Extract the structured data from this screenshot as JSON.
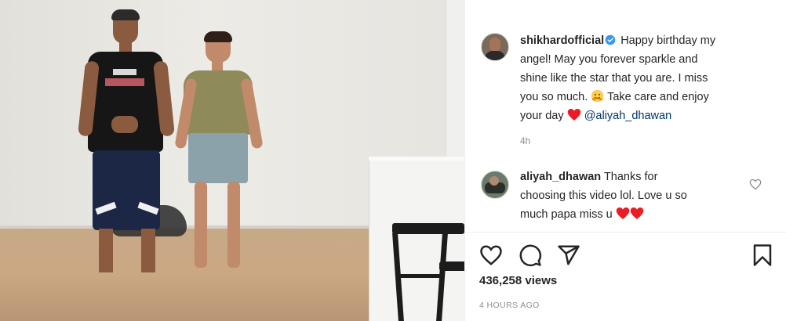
{
  "post": {
    "author": "shikhardofficial",
    "caption_line1": "Happy birthday my",
    "caption_line2": "angel! May you forever sparkle and",
    "caption_line3": "shine like the star that you are. I miss",
    "caption_line4": "you so much.",
    "caption_line5a": "Take care and enjoy",
    "caption_line6a": "your day",
    "mention": "@aliyah_dhawan",
    "caption_time": "4h"
  },
  "comment": {
    "author": "aliyah_dhawan",
    "line1": "Thanks for",
    "line2": "choosing this video lol. Love u so",
    "line3": "much papa miss u"
  },
  "stats": {
    "views": "436,258 views",
    "posted": "4 HOURS AGO"
  },
  "icons": {
    "like": "heart-outline-icon",
    "comment": "comment-bubble-icon",
    "share": "paper-plane-icon",
    "save": "bookmark-icon",
    "verified": "verified-badge-icon",
    "heart_emoji": "red-heart-emoji",
    "hug_emoji": "hugging-face-emoji"
  },
  "colors": {
    "verified": "#3897f0",
    "mention": "#00376b",
    "heart": "#ed1c24",
    "muted": "#8e8e8e"
  }
}
